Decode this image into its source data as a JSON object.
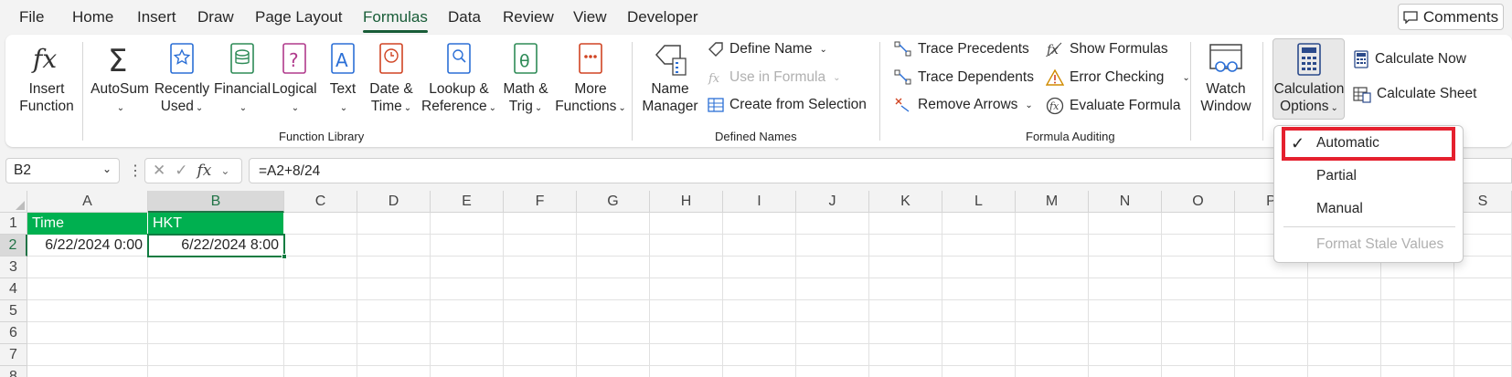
{
  "tabs": [
    "File",
    "Home",
    "Insert",
    "Draw",
    "Page Layout",
    "Formulas",
    "Data",
    "Review",
    "View",
    "Developer"
  ],
  "active_tab": "Formulas",
  "comments_label": "Comments",
  "function_library": {
    "insert_function": [
      "Insert",
      "Function"
    ],
    "autosum": "AutoSum",
    "recently_used": [
      "Recently",
      "Used"
    ],
    "financial": "Financial",
    "logical": "Logical",
    "text": "Text",
    "date_time": [
      "Date &",
      "Time"
    ],
    "lookup_reference": [
      "Lookup &",
      "Reference"
    ],
    "math_trig": [
      "Math &",
      "Trig"
    ],
    "more_functions": [
      "More",
      "Functions"
    ],
    "label": "Function Library"
  },
  "defined_names": {
    "name_manager": [
      "Name",
      "Manager"
    ],
    "define_name": "Define Name",
    "use_in_formula": "Use in Formula",
    "create_from_selection": "Create from Selection",
    "label": "Defined Names"
  },
  "formula_auditing": {
    "trace_precedents": "Trace Precedents",
    "trace_dependents": "Trace Dependents",
    "remove_arrows": "Remove Arrows",
    "show_formulas": "Show Formulas",
    "error_checking": "Error Checking",
    "evaluate_formula": "Evaluate Formula",
    "watch_window": [
      "Watch",
      "Window"
    ],
    "label": "Formula Auditing"
  },
  "calculation": {
    "options": [
      "Calculation",
      "Options"
    ],
    "calculate_now": "Calculate Now",
    "calculate_sheet": "Calculate Sheet"
  },
  "formula_bar": {
    "name_box": "B2",
    "formula": "=A2+8/24"
  },
  "columns": [
    "A",
    "B",
    "C",
    "D",
    "E",
    "F",
    "G",
    "H",
    "I",
    "J",
    "K",
    "L",
    "M",
    "N",
    "O",
    "P",
    "Q",
    "R",
    "S"
  ],
  "rows": [
    "1",
    "2",
    "3",
    "4",
    "5",
    "6",
    "7",
    "8"
  ],
  "cells": {
    "A1": "Time",
    "B1": "HKT",
    "A2": "6/22/2024 0:00",
    "B2": "6/22/2024 8:00"
  },
  "calc_menu": {
    "items": [
      "Automatic",
      "Partial",
      "Manual",
      "Format Stale Values"
    ],
    "checked": "Automatic",
    "highlight_color": "#e5202e"
  },
  "colors": {
    "header_fill": "#00b050",
    "accent": "#185c37",
    "selection": "#107c41"
  }
}
